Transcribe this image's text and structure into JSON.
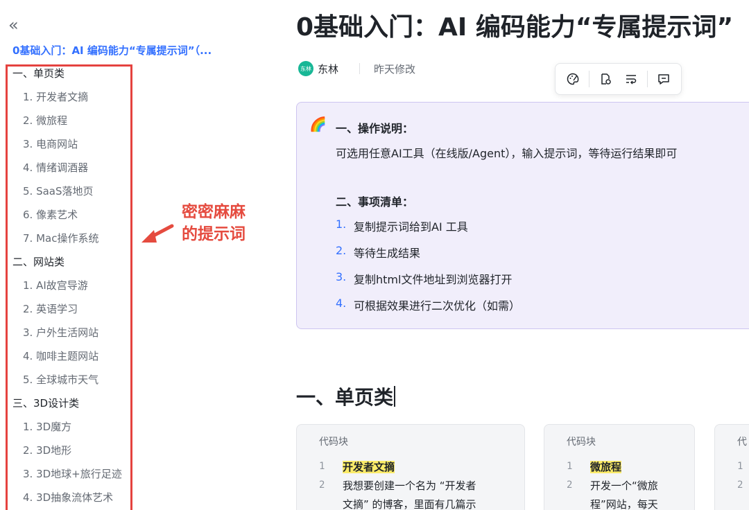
{
  "sidebar": {
    "collapse_icon": "«",
    "doc_link": "0基础入门：AI 编码能力“专属提示词”（...",
    "toc": [
      {
        "label": "一、单页类",
        "level": 1
      },
      {
        "label": "1. 开发者文摘",
        "level": 2
      },
      {
        "label": "2. 微旅程",
        "level": 2
      },
      {
        "label": "3. 电商网站",
        "level": 2
      },
      {
        "label": "4. 情绪调酒器",
        "level": 2
      },
      {
        "label": "5. SaaS落地页",
        "level": 2
      },
      {
        "label": "6. 像素艺术",
        "level": 2
      },
      {
        "label": "7. Mac操作系统",
        "level": 2
      },
      {
        "label": "二、网站类",
        "level": 1
      },
      {
        "label": "1. AI故宫导游",
        "level": 2
      },
      {
        "label": "2. 英语学习",
        "level": 2
      },
      {
        "label": "3. 户外生活网站",
        "level": 2
      },
      {
        "label": "4. 咖啡主题网站",
        "level": 2
      },
      {
        "label": "5. 全球城市天气",
        "level": 2
      },
      {
        "label": "三、3D设计类",
        "level": 1
      },
      {
        "label": "1. 3D魔方",
        "level": 2
      },
      {
        "label": "2. 3D地形",
        "level": 2
      },
      {
        "label": "3. 3D地球+旅行足迹",
        "level": 2
      },
      {
        "label": "4. 3D抽象流体艺术",
        "level": 2
      }
    ]
  },
  "annotation": {
    "line1": "密密麻麻",
    "line2": "的提示词",
    "color": "#e54b3f"
  },
  "doc": {
    "title": "0基础入门：AI 编码能力“专属提示词”",
    "avatar_text": "东林",
    "author": "东林",
    "modified": "昨天修改"
  },
  "callout": {
    "emoji": "🌈",
    "heading1": "一、操作说明：",
    "text1": "可选用任意AI工具（在线版/Agent），输入提示词，等待运行结果即可",
    "heading2": "二、事项清单：",
    "items": [
      {
        "num": "1.",
        "text": "复制提示词给到AI 工具"
      },
      {
        "num": "2.",
        "text": "等待生成结果"
      },
      {
        "num": "3.",
        "text": "复制html文件地址到浏览器打开"
      },
      {
        "num": "4.",
        "text": "可根据效果进行二次优化（如需）"
      }
    ]
  },
  "section": {
    "title": "一、单页类"
  },
  "code_blocks": [
    {
      "label": "代码块",
      "lines": [
        {
          "n": "1",
          "text": "开发者文摘"
        },
        {
          "n": "2",
          "text": "我想要创建一个名为 “开发者"
        },
        {
          "n": "",
          "text": "文摘” 的博客，里面有几篇示"
        }
      ]
    },
    {
      "label": "代码块",
      "lines": [
        {
          "n": "1",
          "text": "微旅程"
        },
        {
          "n": "2",
          "text": "开发一个“微旅"
        },
        {
          "n": "",
          "text": "程”网站，每天"
        }
      ]
    },
    {
      "label": "代",
      "lines": [
        {
          "n": "1",
          "text": ""
        },
        {
          "n": "2",
          "text": ""
        }
      ]
    }
  ],
  "colors": {
    "accent": "#3370ff",
    "highlight": "#fbeb69",
    "callout_bg": "#f1eefb",
    "toc_border": "#e5423f"
  }
}
